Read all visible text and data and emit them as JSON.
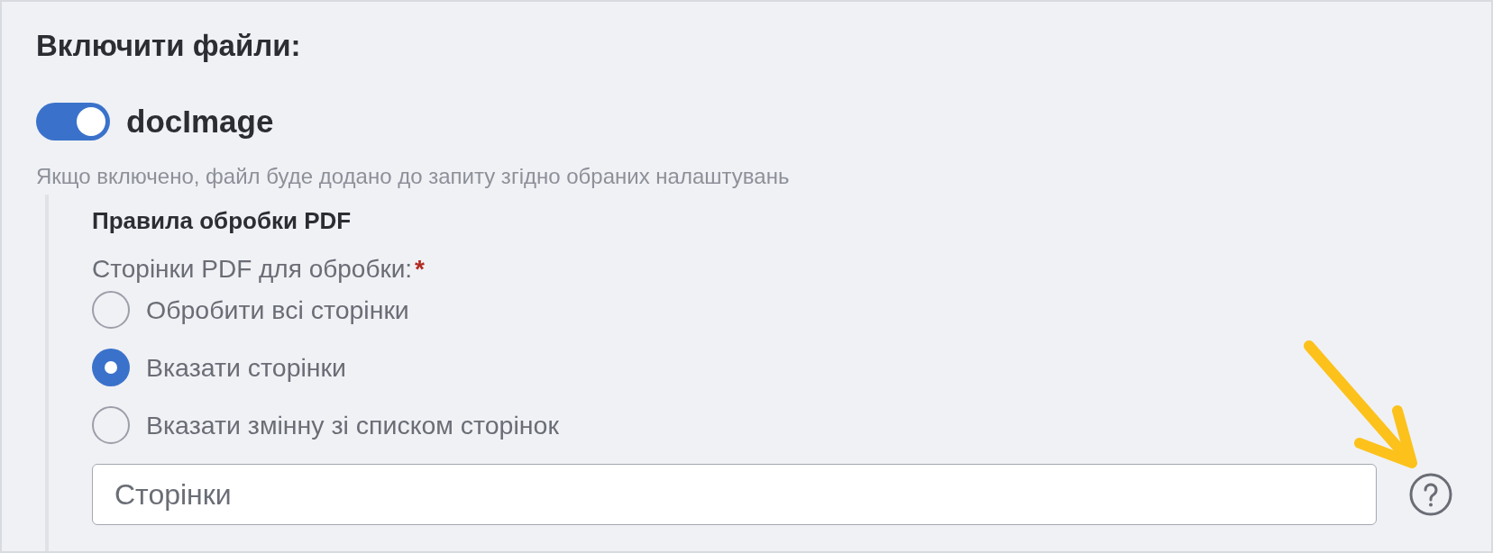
{
  "section": {
    "title": "Включити файли:"
  },
  "toggle": {
    "label": "docImage",
    "on": true,
    "hint": "Якщо включено, файл буде додано до запиту згідно обраних налаштувань"
  },
  "pdf_rules": {
    "title": "Правила обробки PDF",
    "field_label": "Сторінки PDF для обробки:",
    "required_mark": "*",
    "options": [
      {
        "label": "Обробити всі сторінки",
        "selected": false
      },
      {
        "label": "Вказати сторінки",
        "selected": true
      },
      {
        "label": "Вказати змінну зі списком сторінок",
        "selected": false
      }
    ],
    "pages_field": {
      "placeholder": "Сторінки"
    }
  }
}
